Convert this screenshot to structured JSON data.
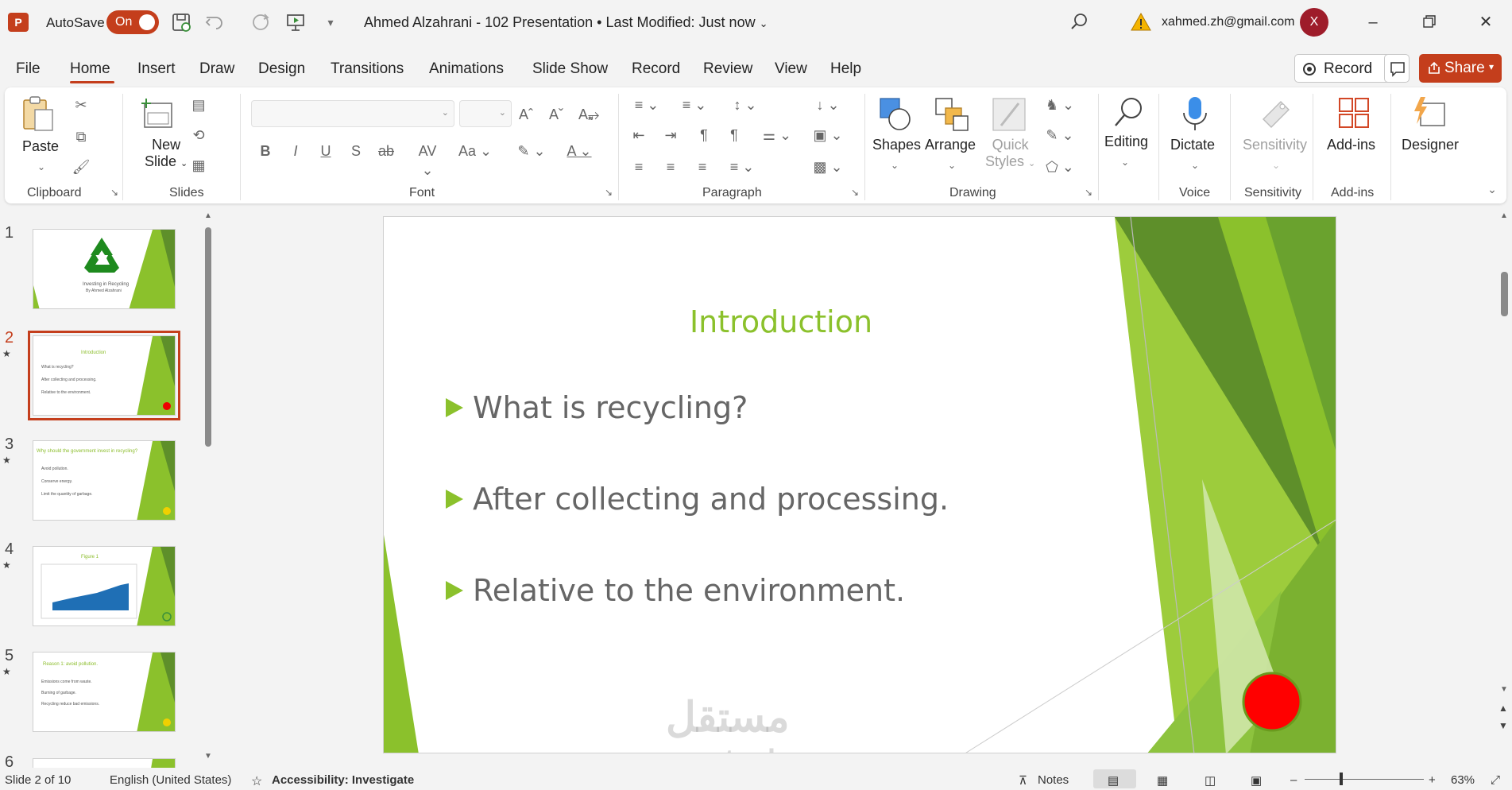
{
  "titlebar": {
    "app_logo": "P",
    "autosave_label": "AutoSave",
    "autosave_state": "On",
    "doc_title": "Ahmed Alzahrani - 102 Presentation • Last Modified: Just now",
    "user_email": "xahmed.zh@gmail.com",
    "avatar_initial": "X"
  },
  "menu": {
    "tabs": [
      "File",
      "Home",
      "Insert",
      "Draw",
      "Design",
      "Transitions",
      "Animations",
      "Slide Show",
      "Record",
      "Review",
      "View",
      "Help"
    ],
    "active_tab": "Home",
    "record_label": "Record",
    "share_label": "Share"
  },
  "ribbon": {
    "paste": "Paste",
    "new_slide_1": "New",
    "new_slide_2": "Slide",
    "shapes": "Shapes",
    "arrange": "Arrange",
    "quick_styles_1": "Quick",
    "quick_styles_2": "Styles",
    "editing": "Editing",
    "dictate": "Dictate",
    "sensitivity": "Sensitivity",
    "addins": "Add-ins",
    "designer": "Designer",
    "groups": {
      "clipboard": "Clipboard",
      "slides": "Slides",
      "font": "Font",
      "paragraph": "Paragraph",
      "drawing": "Drawing",
      "voice": "Voice",
      "sensitivity": "Sensitivity",
      "addins": "Add-ins"
    }
  },
  "thumbnails": [
    {
      "num": "1",
      "title": "Investing in Recycling",
      "lines": [
        "By Ahmed Alzahrani"
      ]
    },
    {
      "num": "2",
      "title": "Introduction",
      "lines": [
        "What is recycling?",
        "After collecting and processing.",
        "Relative to the environment."
      ]
    },
    {
      "num": "3",
      "title": "Why should the government invest in recycling?",
      "lines": [
        "Avoid pollution.",
        "Conserve energy.",
        "Limit the quantity of garbage."
      ]
    },
    {
      "num": "4",
      "title": "Figure 1",
      "lines": []
    },
    {
      "num": "5",
      "title": "Reason 1: avoid pollution.",
      "lines": [
        "Emissions come from waste.",
        "Burning of garbage.",
        "Recycling reduce bad emissions."
      ]
    },
    {
      "num": "6",
      "title": "",
      "lines": []
    }
  ],
  "slide": {
    "title": "Introduction",
    "bullets": [
      "What is recycling?",
      "After collecting and processing.",
      "Relative to the environment."
    ],
    "watermark_ar": "مستقل",
    "watermark_en": "mostaql.com"
  },
  "status": {
    "slide_info": "Slide 2 of 10",
    "language": "English (United States)",
    "accessibility": "Accessibility: Investigate",
    "notes": "Notes",
    "zoom": "63%"
  },
  "colors": {
    "accent": "#c43e1c",
    "slide_green": "#8bc12c"
  }
}
